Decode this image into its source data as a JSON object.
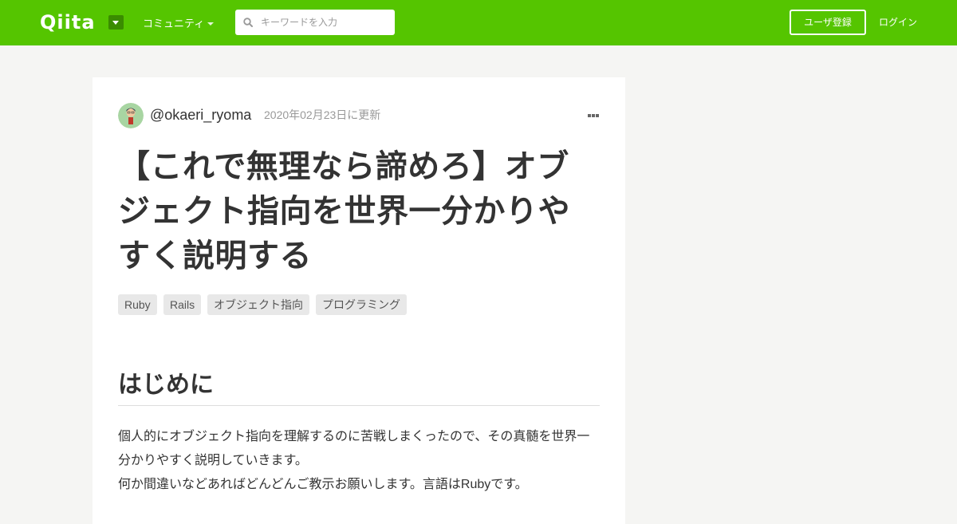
{
  "header": {
    "logo": "Qiita",
    "community_label": "コミュニティ",
    "search_placeholder": "キーワードを入力",
    "signup_label": "ユーザ登録",
    "login_label": "ログイン",
    "brand_color": "#55c500"
  },
  "article": {
    "author": "@okaeri_ryoma",
    "updated": "2020年02月23日に更新",
    "title": "【これで無理なら諦めろ】オブジェクト指向を世界一分かりやすく説明する",
    "tags": [
      "Ruby",
      "Rails",
      "オブジェクト指向",
      "プログラミング"
    ],
    "section_heading": "はじめに",
    "paragraph_lines": [
      "個人的にオブジェクト指向を理解するのに苦戦しまくったので、その真髄を世界一",
      "分かりやすく説明していきます。",
      "何か間違いなどあればどんどんご教示お願いします。言語はRubyです。"
    ]
  }
}
